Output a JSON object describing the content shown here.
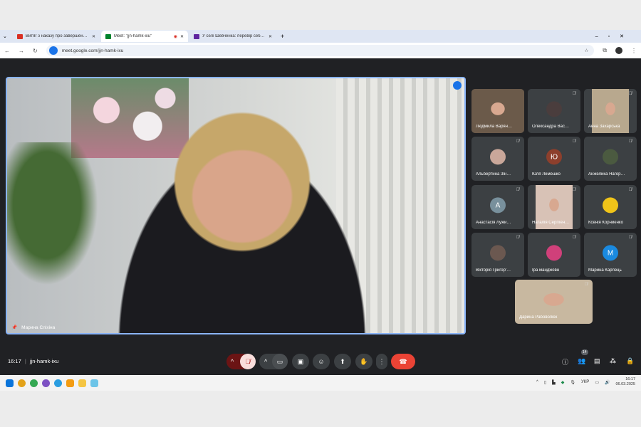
{
  "browser": {
    "tabs": [
      {
        "title": "Витяг з наказу про завершен…",
        "color": "#d93025"
      },
      {
        "title": "Meet: \"jjn-hamk-ixu\"",
        "color": "#00832d"
      },
      {
        "title": "У селі Шевченка: перевір себ…",
        "color": "#5f259f"
      }
    ],
    "url": "meet.google.com/jjn-hamk-ixu"
  },
  "main": {
    "speaker": "Марина Єліхіна"
  },
  "participants": [
    {
      "name": "Людмила Варян…",
      "type": "video",
      "color": "#6b5a4a"
    },
    {
      "name": "Олександра Вас…",
      "type": "photo",
      "color": "#4a3d3d"
    },
    {
      "name": "Анна Захарська",
      "type": "video",
      "color": "#b8a88e"
    },
    {
      "name": "Альбертина Зін…",
      "type": "photo",
      "color": "#c9a79a"
    },
    {
      "name": "Юля Лемешко",
      "type": "letter",
      "letter": "Ю",
      "color": "#8d3f2c"
    },
    {
      "name": "Анжелика Нагор…",
      "type": "photo",
      "color": "#4b5a40"
    },
    {
      "name": "Анастасія Лужи…",
      "type": "letter",
      "letter": "А",
      "color": "#78909c"
    },
    {
      "name": "Наталія Сергіїен…",
      "type": "video",
      "color": "#d8c2b6"
    },
    {
      "name": "Ксенія Корниенко",
      "type": "photo",
      "color": "#f0c419"
    },
    {
      "name": "Вікторія Григор'…",
      "type": "photo",
      "color": "#6b5850"
    },
    {
      "name": "Іра манджовн",
      "type": "photo",
      "color": "#d0407a"
    },
    {
      "name": "Марина Карпець",
      "type": "letter",
      "letter": "М",
      "color": "#1a8ae0"
    },
    {
      "name": "Дарина Рабоволюк",
      "type": "video",
      "color": "#c8b8a0"
    }
  ],
  "bottom": {
    "time": "16:17",
    "separator": "|",
    "code": "jjn-hamk-ixu",
    "people_count": "14"
  },
  "taskbar": {
    "lang": "УКР",
    "time": "16:17",
    "date": "06.03.2025"
  }
}
